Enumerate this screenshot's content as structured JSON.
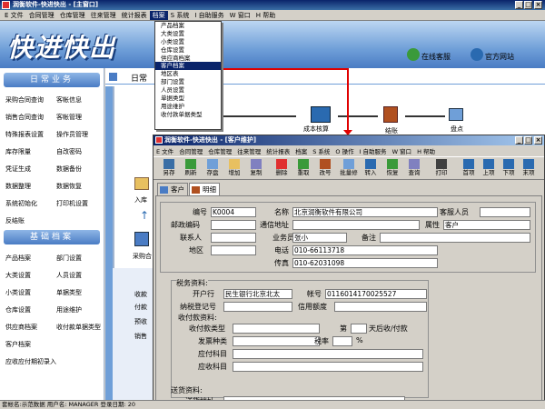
{
  "main_window": {
    "title": "润衡软件-快进快出 - [主窗口]",
    "menu": [
      "E 文件",
      "合同管理",
      "仓库管理",
      "往来管理",
      "统计报表",
      "档案",
      "S 系统",
      "I 自助服务",
      "W 窗口",
      "H 帮助"
    ],
    "active_menu_index": 5
  },
  "banner": {
    "logo": "快进快出",
    "online_service": "在线客服",
    "official_site": "官方网站"
  },
  "left_panel": {
    "daily_header": "日常业务",
    "daily_items": [
      [
        "采购合同查询",
        "客帐信息"
      ],
      [
        "销售合同查询",
        "客帐管理"
      ],
      [
        "特殊报表设置",
        "操作员管理"
      ],
      [
        "库存限量",
        "自改密码"
      ],
      [
        "凭证生成",
        "数据备份"
      ],
      [
        "数据整理",
        "数据恢复"
      ],
      [
        "系统初始化",
        "打印机设置"
      ],
      [
        "反结账",
        ""
      ]
    ],
    "archive_header": "基础档案",
    "archive_items": [
      [
        "产品档案",
        "部门设置"
      ],
      [
        "大类设置",
        "人员设置"
      ],
      [
        "小类设置",
        "单据类型"
      ],
      [
        "仓库设置",
        "用途维护"
      ],
      [
        "供应商档案",
        "收付款单据类型"
      ],
      [
        "客户档案",
        ""
      ],
      [
        "应收应付期初录入",
        ""
      ]
    ]
  },
  "right_main": {
    "tab_label": "日常",
    "flow_labels": [
      "成本核算",
      "结账",
      "盘点"
    ],
    "side_labels": [
      "入库",
      "采购合"
    ],
    "bottom_items": [
      "收款",
      "付款",
      "预收",
      "销售"
    ]
  },
  "dropdown": {
    "items": [
      "产品档案",
      "大类设置",
      "小类设置",
      "仓库设置",
      "供应商档案",
      "客户档案",
      "地区表",
      "部门设置",
      "人员设置",
      "单据类型",
      "用途维护",
      "收付款单据类型"
    ],
    "highlighted_index": 5
  },
  "sub_window": {
    "title": "润衡软件-快进快出 - [客户维护]",
    "menu": [
      "E 文件",
      "合同管理",
      "仓库管理",
      "往来管理",
      "统计报表",
      "档案",
      "S 系统",
      "O 操作",
      "I 自助服务",
      "W 窗口",
      "H 帮助"
    ],
    "toolbar": [
      "另存",
      "刷新",
      "存盘",
      "增加",
      "复制",
      "删除",
      "重取",
      "改号",
      "批量修",
      "转入",
      "恢复",
      "查询",
      "打印",
      "首项",
      "上项",
      "下项",
      "末项"
    ],
    "tabs": [
      "客户",
      "明细"
    ],
    "active_tab_index": 1,
    "form": {
      "code_label": "编号",
      "code_value": "K0004",
      "name_label": "名称",
      "name_value": "北京润衡软件有限公司",
      "customer_staff_label": "客服人员",
      "customer_staff_value": "",
      "zip_label": "邮政编码",
      "zip_value": "",
      "address_label": "通信地址",
      "address_value": "",
      "attribute_label": "属性",
      "attribute_value": "客户",
      "contact_label": "联系人",
      "contact_value": "",
      "salesman_label": "业务员",
      "salesman_value": "张小",
      "remark_label": "备注",
      "remark_value": "",
      "region_label": "地区",
      "region_value": "",
      "phone_label": "电话",
      "phone_value": "010-66113718",
      "fax_label": "传真",
      "fax_value": "010-62031098",
      "tax_group": "税务资料:",
      "bank_label": "开户行",
      "bank_value": "民生银行北京北太",
      "account_label": "帐号",
      "account_value": "0116014170025527",
      "tax_no_label": "纳税登记号",
      "tax_no_value": "",
      "credit_label": "信用额度",
      "credit_value": "",
      "payment_group": "收付款资料:",
      "payment_type_label": "收付款类型",
      "payment_type_value": "",
      "payment_days_prefix": "第",
      "payment_days_suffix": "天后收/付款",
      "invoice_label": "发票种类",
      "invoice_value": "",
      "tax_rate_label": "税率",
      "tax_rate_unit": "%",
      "payable_label": "应付科目",
      "payable_value": "",
      "receivable_label": "应收科目",
      "receivable_value": "",
      "delivery_group": "送货资料:",
      "delivery_address_label": "送货地址",
      "delivery_address_value": ""
    }
  },
  "statusbar": "套帐名:示范数据   用户名: MANAGER   登录日期: 20"
}
